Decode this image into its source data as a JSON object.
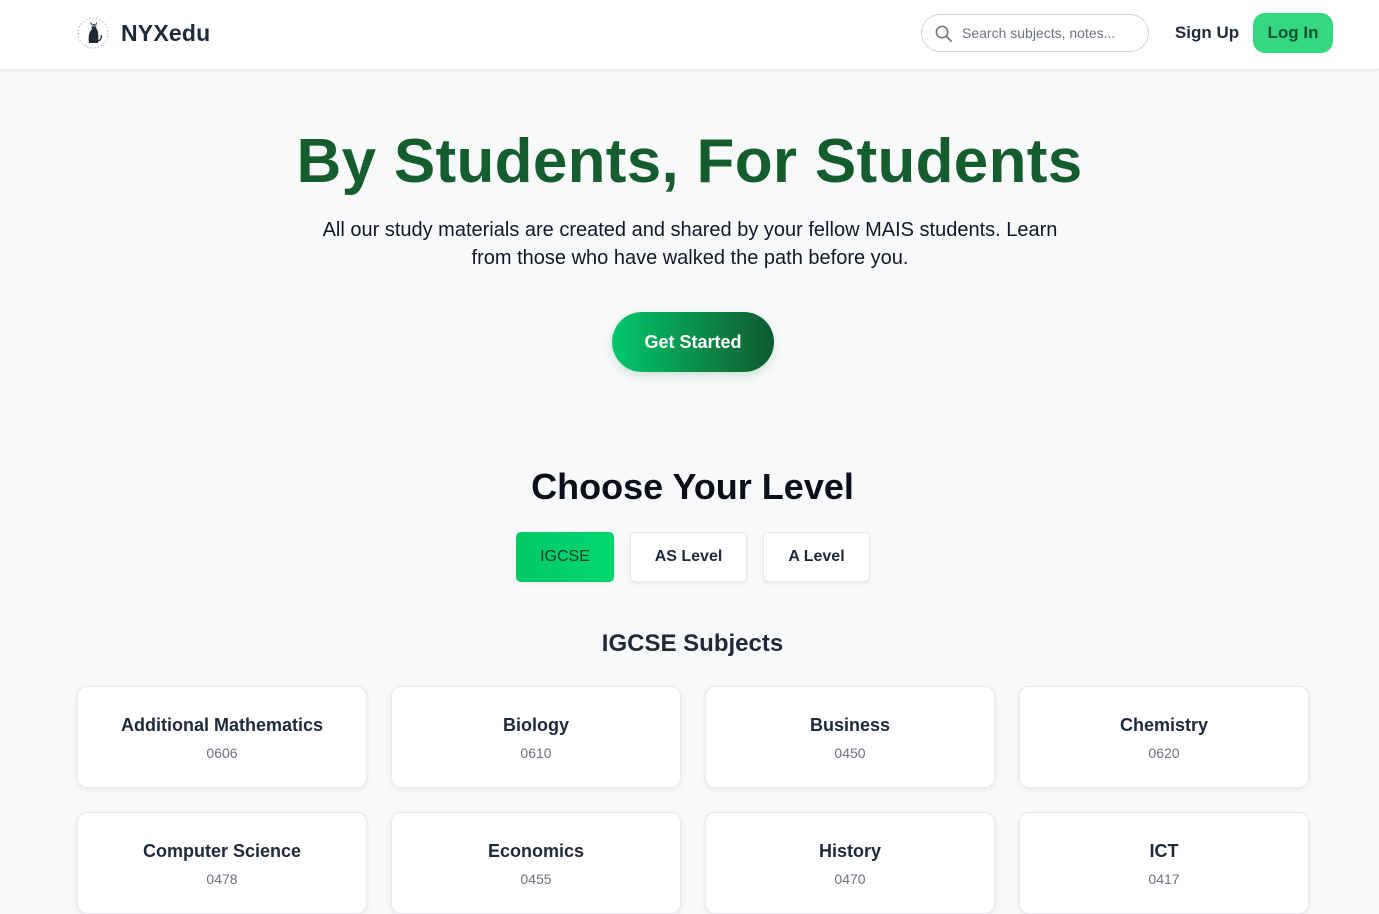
{
  "header": {
    "brand_name": "NYXedu",
    "search_placeholder": "Search subjects, notes...",
    "signup_label": "Sign Up",
    "login_label": "Log In"
  },
  "hero": {
    "title": "By Students, For Students",
    "subtitle": "All our study materials are created and shared by your fellow MAIS students. Learn from those who have walked the path before you.",
    "cta_label": "Get Started"
  },
  "levels": {
    "title": "Choose Your Level",
    "options": [
      "IGCSE",
      "AS Level",
      "A Level"
    ],
    "selected": "IGCSE"
  },
  "subjects": {
    "title": "IGCSE Subjects",
    "items": [
      {
        "name": "Additional Mathematics",
        "code": "0606"
      },
      {
        "name": "Biology",
        "code": "0610"
      },
      {
        "name": "Business",
        "code": "0450"
      },
      {
        "name": "Chemistry",
        "code": "0620"
      },
      {
        "name": "Computer Science",
        "code": "0478"
      },
      {
        "name": "Economics",
        "code": "0455"
      },
      {
        "name": "History",
        "code": "0470"
      },
      {
        "name": "ICT",
        "code": "0417"
      }
    ]
  },
  "colors": {
    "accent_green": "#00c96a",
    "hero_title": "#155d2e",
    "login_bg": "#34d881"
  }
}
